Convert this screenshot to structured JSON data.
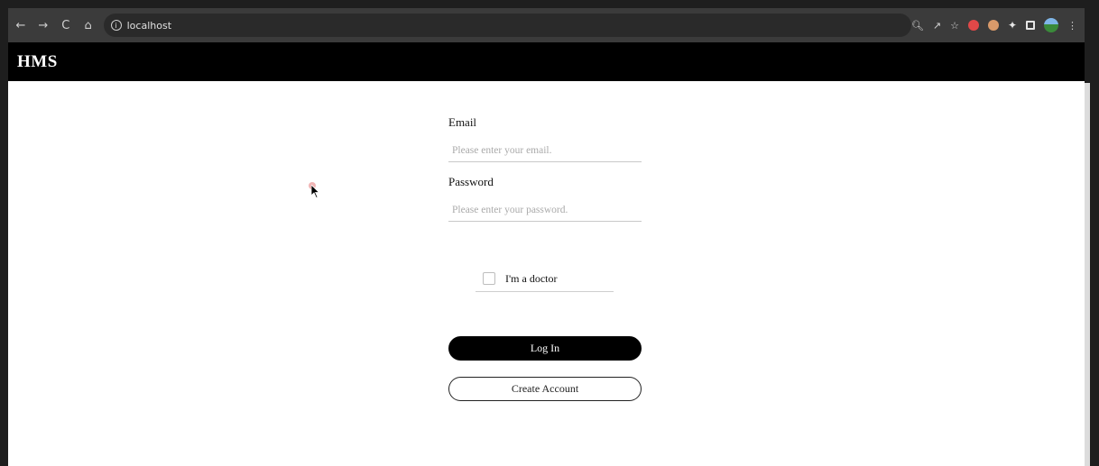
{
  "browser": {
    "back": "←",
    "forward": "→",
    "reload": "C",
    "home": "⌂",
    "address": "localhost"
  },
  "app": {
    "title": "HMS"
  },
  "form": {
    "email_label": "Email",
    "email_placeholder": "Please enter your email.",
    "password_label": "Password",
    "password_placeholder": "Please enter your password.",
    "doctor_label": "I'm a doctor",
    "doctor_checked": false,
    "login_label": "Log In",
    "create_label": "Create Account"
  },
  "colors": {
    "header_bg": "#000000",
    "browser_bar": "#3b3b3b",
    "button_primary": "#000000"
  }
}
